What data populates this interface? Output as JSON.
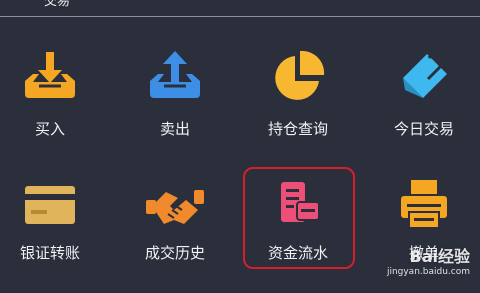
{
  "header": {
    "title": "交易"
  },
  "menu": {
    "items": [
      {
        "label": "买入",
        "icon": "buy-tray-icon",
        "color": "#f5a623"
      },
      {
        "label": "卖出",
        "icon": "sell-tray-icon",
        "color": "#3d8fe6"
      },
      {
        "label": "持仓查询",
        "icon": "pie-chart-icon",
        "color": "#f7b731"
      },
      {
        "label": "今日交易",
        "icon": "paperclip-note-icon",
        "color": "#3fb8f0"
      },
      {
        "label": "银证转账",
        "icon": "bank-card-icon",
        "color": "#e0b45a"
      },
      {
        "label": "成交历史",
        "icon": "handshake-icon",
        "color": "#f08a2c"
      },
      {
        "label": "资金流水",
        "icon": "ledger-card-icon",
        "color": "#ee4f78"
      },
      {
        "label": "撤单",
        "icon": "printer-icon",
        "color": "#f5a623"
      }
    ]
  },
  "highlight": {
    "color": "#d4202a",
    "target": "资金流水"
  },
  "watermark": {
    "brand": "Bai经验",
    "url": "jingyan.baidu.com"
  }
}
